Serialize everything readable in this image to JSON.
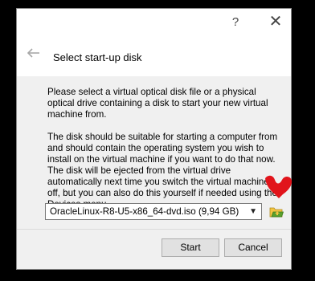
{
  "titlebar": {
    "help_label": "?",
    "close_label": "✕"
  },
  "header": {
    "back_icon": "back-arrow-icon",
    "title": "Select start-up disk"
  },
  "body": {
    "paragraph1": "Please select a virtual optical disk file or a physical optical drive containing a disk to start your new virtual machine from.",
    "paragraph2": "The disk should be suitable for starting a computer from and should contain the operating system you wish to install on the virtual machine if you want to do that now. The disk will be ejected from the virtual drive automatically next time you switch the virtual machine off, but you can also do this yourself if needed using the Devices menu."
  },
  "disk_selector": {
    "selected_value": "OracleLinux-R8-U5-x86_64-dvd.iso (9,94 GB)",
    "folder_icon": "folder-open-icon"
  },
  "buttons": {
    "start_label": "Start",
    "cancel_label": "Cancel"
  },
  "colors": {
    "annotation_red": "#e1141b",
    "folder_green": "#5aa02c",
    "folder_yellow": "#f4c542"
  }
}
